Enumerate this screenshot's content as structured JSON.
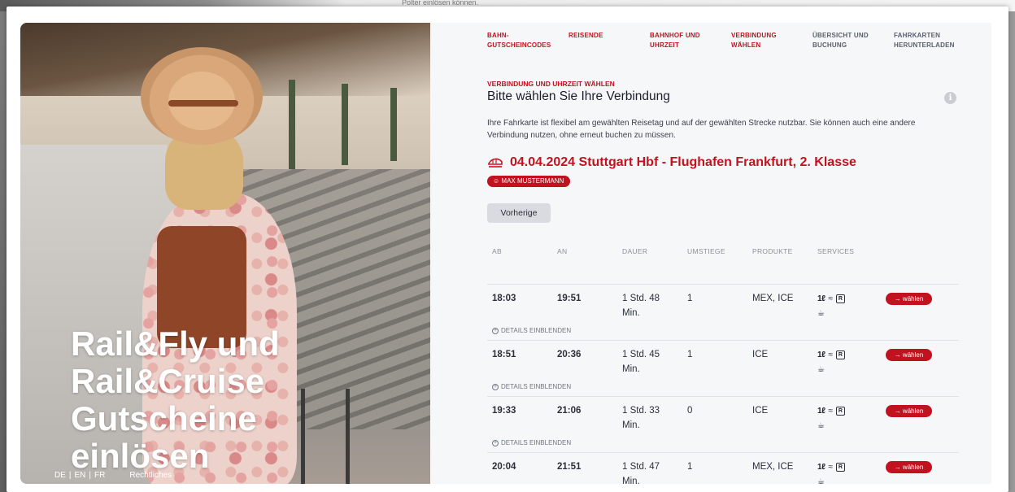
{
  "background": {
    "partial_text": "Polter einlösen können."
  },
  "hero": {
    "title_lines": [
      "Rail&Fly und",
      "Rail&Cruise",
      "Gutscheine",
      "einlösen"
    ],
    "lang_de": "DE",
    "lang_en": "EN",
    "lang_fr": "FR",
    "separator": "|",
    "legal_link": "Rechtliches"
  },
  "steps": [
    {
      "label": "BAHN-\nGUTSCHEINCODES",
      "state": "active"
    },
    {
      "label": "REISENDE",
      "state": "active"
    },
    {
      "label": "BAHNHOF UND\nUHRZEIT",
      "state": "active"
    },
    {
      "label": "VERBINDUNG\nWÄHLEN",
      "state": "active"
    },
    {
      "label": "ÜBERSICHT UND\nBUCHUNG",
      "state": "inactive"
    },
    {
      "label": "FAHRKARTEN\nHERUNTERLADEN",
      "state": "inactive"
    }
  ],
  "main": {
    "overline": "VERBINDUNG UND UHRZEIT WÄHLEN",
    "heading": "Bitte wählen Sie Ihre Verbindung",
    "info_icon": "info-icon",
    "description": "Ihre Fahrkarte ist flexibel am gewählten Reisetag und auf der gewählten Strecke nutzbar. Sie können auch eine andere Verbindung nutzen, ohne erneut buchen zu müssen.",
    "route": "04.04.2024 Stuttgart Hbf - Flughafen Frankfurt, 2. Klasse",
    "route_icon": "train-icon",
    "passenger": "MAX MUSTERMANN",
    "passenger_icon": "person-icon",
    "prev_button": "Vorherige"
  },
  "table": {
    "headers": {
      "ab": "AB",
      "an": "AN",
      "dauer": "DAUER",
      "umstiege": "UMSTIEGE",
      "produkte": "PRODUKTE",
      "services": "SERVICES"
    },
    "select_label": "→ wählen",
    "details_label": "DETAILS EINBLENDEN",
    "service_icons": {
      "class": "1.Kl. icon",
      "wifi": "wifi-icon",
      "reservation": "reservation-icon",
      "bistro": "cup-icon"
    },
    "rows": [
      {
        "ab": "18:03",
        "an": "19:51",
        "dauer": "1 Std. 48 Min.",
        "umstiege": "1",
        "produkte": "MEX, ICE"
      },
      {
        "ab": "18:51",
        "an": "20:36",
        "dauer": "1 Std. 45 Min.",
        "umstiege": "1",
        "produkte": "ICE"
      },
      {
        "ab": "19:33",
        "an": "21:06",
        "dauer": "1 Std. 33 Min.",
        "umstiege": "0",
        "produkte": "ICE"
      },
      {
        "ab": "20:04",
        "an": "21:51",
        "dauer": "1 Std. 47 Min.",
        "umstiege": "1",
        "produkte": "MEX, ICE"
      }
    ]
  },
  "colors": {
    "accent": "#c2121f",
    "panel": "#f6f7f9",
    "muted": "#8a8f99"
  }
}
